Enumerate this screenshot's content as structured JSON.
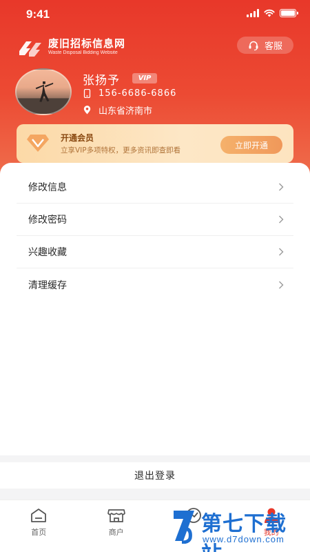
{
  "status_bar": {
    "time": "9:41"
  },
  "brand": {
    "name": "废旧招标信息网",
    "subtitle": "Waste Disposal Bidding Website"
  },
  "service_button": {
    "label": "客服",
    "icon": "headset-icon"
  },
  "profile": {
    "name": "张扬予",
    "badge": "VIP",
    "phone": "156-6686-6866",
    "location": "山东省济南市"
  },
  "vip_card": {
    "title": "开通会员",
    "description": "立享VIP多项特权，更多资讯即查即看",
    "button": "立即开通",
    "icon": "diamond-icon"
  },
  "menu": {
    "items": [
      {
        "label": "修改信息"
      },
      {
        "label": "修改密码"
      },
      {
        "label": "兴趣收藏"
      },
      {
        "label": "清理缓存"
      }
    ]
  },
  "logout": {
    "label": "退出登录"
  },
  "tabbar": {
    "tabs": [
      {
        "label": "首页",
        "icon": "home-icon"
      },
      {
        "label": "商户",
        "icon": "store-icon"
      },
      {
        "label": "",
        "icon": "trend-icon"
      },
      {
        "label": "我的",
        "icon": "user-icon"
      }
    ]
  },
  "watermark": {
    "title": "第七下载站",
    "url": "www.d7down.com"
  },
  "colors": {
    "primary": "#e8382a",
    "vip_gold": "#f0985a",
    "watermark_blue": "#1e6fd1"
  }
}
